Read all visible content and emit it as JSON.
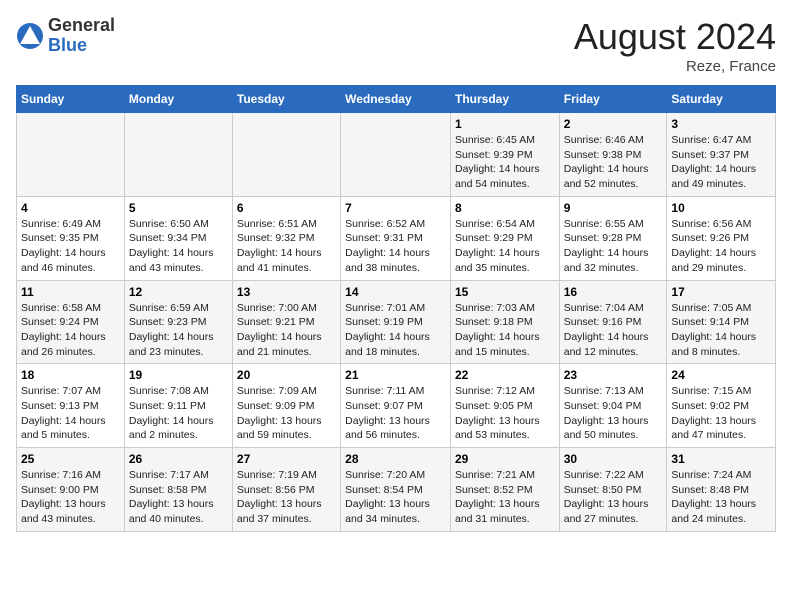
{
  "header": {
    "logo_general": "General",
    "logo_blue": "Blue",
    "month_year": "August 2024",
    "location": "Reze, France"
  },
  "days_of_week": [
    "Sunday",
    "Monday",
    "Tuesday",
    "Wednesday",
    "Thursday",
    "Friday",
    "Saturday"
  ],
  "weeks": [
    [
      {
        "day": "",
        "info": ""
      },
      {
        "day": "",
        "info": ""
      },
      {
        "day": "",
        "info": ""
      },
      {
        "day": "",
        "info": ""
      },
      {
        "day": "1",
        "info": "Sunrise: 6:45 AM\nSunset: 9:39 PM\nDaylight: 14 hours\nand 54 minutes."
      },
      {
        "day": "2",
        "info": "Sunrise: 6:46 AM\nSunset: 9:38 PM\nDaylight: 14 hours\nand 52 minutes."
      },
      {
        "day": "3",
        "info": "Sunrise: 6:47 AM\nSunset: 9:37 PM\nDaylight: 14 hours\nand 49 minutes."
      }
    ],
    [
      {
        "day": "4",
        "info": "Sunrise: 6:49 AM\nSunset: 9:35 PM\nDaylight: 14 hours\nand 46 minutes."
      },
      {
        "day": "5",
        "info": "Sunrise: 6:50 AM\nSunset: 9:34 PM\nDaylight: 14 hours\nand 43 minutes."
      },
      {
        "day": "6",
        "info": "Sunrise: 6:51 AM\nSunset: 9:32 PM\nDaylight: 14 hours\nand 41 minutes."
      },
      {
        "day": "7",
        "info": "Sunrise: 6:52 AM\nSunset: 9:31 PM\nDaylight: 14 hours\nand 38 minutes."
      },
      {
        "day": "8",
        "info": "Sunrise: 6:54 AM\nSunset: 9:29 PM\nDaylight: 14 hours\nand 35 minutes."
      },
      {
        "day": "9",
        "info": "Sunrise: 6:55 AM\nSunset: 9:28 PM\nDaylight: 14 hours\nand 32 minutes."
      },
      {
        "day": "10",
        "info": "Sunrise: 6:56 AM\nSunset: 9:26 PM\nDaylight: 14 hours\nand 29 minutes."
      }
    ],
    [
      {
        "day": "11",
        "info": "Sunrise: 6:58 AM\nSunset: 9:24 PM\nDaylight: 14 hours\nand 26 minutes."
      },
      {
        "day": "12",
        "info": "Sunrise: 6:59 AM\nSunset: 9:23 PM\nDaylight: 14 hours\nand 23 minutes."
      },
      {
        "day": "13",
        "info": "Sunrise: 7:00 AM\nSunset: 9:21 PM\nDaylight: 14 hours\nand 21 minutes."
      },
      {
        "day": "14",
        "info": "Sunrise: 7:01 AM\nSunset: 9:19 PM\nDaylight: 14 hours\nand 18 minutes."
      },
      {
        "day": "15",
        "info": "Sunrise: 7:03 AM\nSunset: 9:18 PM\nDaylight: 14 hours\nand 15 minutes."
      },
      {
        "day": "16",
        "info": "Sunrise: 7:04 AM\nSunset: 9:16 PM\nDaylight: 14 hours\nand 12 minutes."
      },
      {
        "day": "17",
        "info": "Sunrise: 7:05 AM\nSunset: 9:14 PM\nDaylight: 14 hours\nand 8 minutes."
      }
    ],
    [
      {
        "day": "18",
        "info": "Sunrise: 7:07 AM\nSunset: 9:13 PM\nDaylight: 14 hours\nand 5 minutes."
      },
      {
        "day": "19",
        "info": "Sunrise: 7:08 AM\nSunset: 9:11 PM\nDaylight: 14 hours\nand 2 minutes."
      },
      {
        "day": "20",
        "info": "Sunrise: 7:09 AM\nSunset: 9:09 PM\nDaylight: 13 hours\nand 59 minutes."
      },
      {
        "day": "21",
        "info": "Sunrise: 7:11 AM\nSunset: 9:07 PM\nDaylight: 13 hours\nand 56 minutes."
      },
      {
        "day": "22",
        "info": "Sunrise: 7:12 AM\nSunset: 9:05 PM\nDaylight: 13 hours\nand 53 minutes."
      },
      {
        "day": "23",
        "info": "Sunrise: 7:13 AM\nSunset: 9:04 PM\nDaylight: 13 hours\nand 50 minutes."
      },
      {
        "day": "24",
        "info": "Sunrise: 7:15 AM\nSunset: 9:02 PM\nDaylight: 13 hours\nand 47 minutes."
      }
    ],
    [
      {
        "day": "25",
        "info": "Sunrise: 7:16 AM\nSunset: 9:00 PM\nDaylight: 13 hours\nand 43 minutes."
      },
      {
        "day": "26",
        "info": "Sunrise: 7:17 AM\nSunset: 8:58 PM\nDaylight: 13 hours\nand 40 minutes."
      },
      {
        "day": "27",
        "info": "Sunrise: 7:19 AM\nSunset: 8:56 PM\nDaylight: 13 hours\nand 37 minutes."
      },
      {
        "day": "28",
        "info": "Sunrise: 7:20 AM\nSunset: 8:54 PM\nDaylight: 13 hours\nand 34 minutes."
      },
      {
        "day": "29",
        "info": "Sunrise: 7:21 AM\nSunset: 8:52 PM\nDaylight: 13 hours\nand 31 minutes."
      },
      {
        "day": "30",
        "info": "Sunrise: 7:22 AM\nSunset: 8:50 PM\nDaylight: 13 hours\nand 27 minutes."
      },
      {
        "day": "31",
        "info": "Sunrise: 7:24 AM\nSunset: 8:48 PM\nDaylight: 13 hours\nand 24 minutes."
      }
    ]
  ]
}
